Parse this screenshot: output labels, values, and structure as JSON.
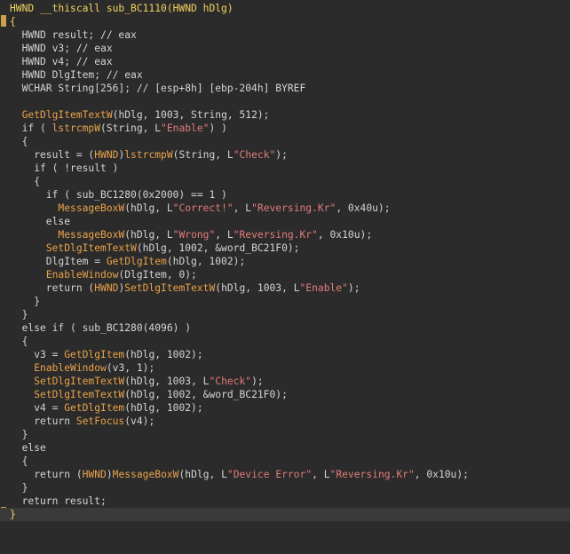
{
  "editor": {
    "signature": "HWND __thiscall sub_BC1110(HWND hDlg)",
    "lines": [
      [
        {
          "t": "HWND __thiscall sub_BC1110(HWND hDlg)",
          "c": "head"
        }
      ],
      [
        {
          "t": "{",
          "c": "brace"
        }
      ],
      [
        {
          "t": "  HWND result; // eax",
          "c": "var"
        }
      ],
      [
        {
          "t": "  HWND v3; // eax",
          "c": "var"
        }
      ],
      [
        {
          "t": "  HWND v4; // eax",
          "c": "var"
        }
      ],
      [
        {
          "t": "  HWND DlgItem; // eax",
          "c": "var"
        }
      ],
      [
        {
          "t": "  WCHAR String[256]; // [esp+8h] [ebp-204h] BYREF",
          "c": "var"
        }
      ],
      [
        {
          "t": "",
          "c": "var"
        }
      ],
      [
        {
          "t": "  ",
          "c": "var"
        },
        {
          "t": "GetDlgItemTextW",
          "c": "fn"
        },
        {
          "t": "(hDlg, 1003, String, 512);",
          "c": "var"
        }
      ],
      [
        {
          "t": "  if ( ",
          "c": "var"
        },
        {
          "t": "lstrcmpW",
          "c": "fn"
        },
        {
          "t": "(String, L",
          "c": "var"
        },
        {
          "t": "\"Enable\"",
          "c": "str"
        },
        {
          "t": ") )",
          "c": "var"
        }
      ],
      [
        {
          "t": "  {",
          "c": "var"
        }
      ],
      [
        {
          "t": "    result = (",
          "c": "var"
        },
        {
          "t": "HWND",
          "c": "fn"
        },
        {
          "t": ")",
          "c": "var"
        },
        {
          "t": "lstrcmpW",
          "c": "fn"
        },
        {
          "t": "(String, L",
          "c": "var"
        },
        {
          "t": "\"Check\"",
          "c": "str"
        },
        {
          "t": ");",
          "c": "var"
        }
      ],
      [
        {
          "t": "    if ( !result )",
          "c": "var"
        }
      ],
      [
        {
          "t": "    {",
          "c": "var"
        }
      ],
      [
        {
          "t": "      if ( sub_BC1280(0x2000) == 1 )",
          "c": "var"
        }
      ],
      [
        {
          "t": "        ",
          "c": "var"
        },
        {
          "t": "MessageBoxW",
          "c": "fn"
        },
        {
          "t": "(hDlg, L",
          "c": "var"
        },
        {
          "t": "\"Correct!\"",
          "c": "str"
        },
        {
          "t": ", L",
          "c": "var"
        },
        {
          "t": "\"Reversing.Kr\"",
          "c": "str"
        },
        {
          "t": ", 0x40u);",
          "c": "var"
        }
      ],
      [
        {
          "t": "      else",
          "c": "var"
        }
      ],
      [
        {
          "t": "        ",
          "c": "var"
        },
        {
          "t": "MessageBoxW",
          "c": "fn"
        },
        {
          "t": "(hDlg, L",
          "c": "var"
        },
        {
          "t": "\"Wrong\"",
          "c": "str"
        },
        {
          "t": ", L",
          "c": "var"
        },
        {
          "t": "\"Reversing.Kr\"",
          "c": "str"
        },
        {
          "t": ", 0x10u);",
          "c": "var"
        }
      ],
      [
        {
          "t": "      ",
          "c": "var"
        },
        {
          "t": "SetDlgItemTextW",
          "c": "fn"
        },
        {
          "t": "(hDlg, 1002, &word_BC21F0);",
          "c": "var"
        }
      ],
      [
        {
          "t": "      DlgItem = ",
          "c": "var"
        },
        {
          "t": "GetDlgItem",
          "c": "fn"
        },
        {
          "t": "(hDlg, 1002);",
          "c": "var"
        }
      ],
      [
        {
          "t": "      ",
          "c": "var"
        },
        {
          "t": "EnableWindow",
          "c": "fn"
        },
        {
          "t": "(DlgItem, 0);",
          "c": "var"
        }
      ],
      [
        {
          "t": "      return (",
          "c": "var"
        },
        {
          "t": "HWND",
          "c": "fn"
        },
        {
          "t": ")",
          "c": "var"
        },
        {
          "t": "SetDlgItemTextW",
          "c": "fn"
        },
        {
          "t": "(hDlg, 1003, L",
          "c": "var"
        },
        {
          "t": "\"Enable\"",
          "c": "str"
        },
        {
          "t": ");",
          "c": "var"
        }
      ],
      [
        {
          "t": "    }",
          "c": "var"
        }
      ],
      [
        {
          "t": "  }",
          "c": "var"
        }
      ],
      [
        {
          "t": "  else if ( sub_BC1280(4096) )",
          "c": "var"
        }
      ],
      [
        {
          "t": "  {",
          "c": "var"
        }
      ],
      [
        {
          "t": "    v3 = ",
          "c": "var"
        },
        {
          "t": "GetDlgItem",
          "c": "fn"
        },
        {
          "t": "(hDlg, 1002);",
          "c": "var"
        }
      ],
      [
        {
          "t": "    ",
          "c": "var"
        },
        {
          "t": "EnableWindow",
          "c": "fn"
        },
        {
          "t": "(v3, 1);",
          "c": "var"
        }
      ],
      [
        {
          "t": "    ",
          "c": "var"
        },
        {
          "t": "SetDlgItemTextW",
          "c": "fn"
        },
        {
          "t": "(hDlg, 1003, L",
          "c": "var"
        },
        {
          "t": "\"Check\"",
          "c": "str"
        },
        {
          "t": ");",
          "c": "var"
        }
      ],
      [
        {
          "t": "    ",
          "c": "var"
        },
        {
          "t": "SetDlgItemTextW",
          "c": "fn"
        },
        {
          "t": "(hDlg, 1002, &word_BC21F0);",
          "c": "var"
        }
      ],
      [
        {
          "t": "    v4 = ",
          "c": "var"
        },
        {
          "t": "GetDlgItem",
          "c": "fn"
        },
        {
          "t": "(hDlg, 1002);",
          "c": "var"
        }
      ],
      [
        {
          "t": "    return ",
          "c": "var"
        },
        {
          "t": "SetFocus",
          "c": "fn"
        },
        {
          "t": "(v4);",
          "c": "var"
        }
      ],
      [
        {
          "t": "  }",
          "c": "var"
        }
      ],
      [
        {
          "t": "  else",
          "c": "var"
        }
      ],
      [
        {
          "t": "  {",
          "c": "var"
        }
      ],
      [
        {
          "t": "    return (",
          "c": "var"
        },
        {
          "t": "HWND",
          "c": "fn"
        },
        {
          "t": ")",
          "c": "var"
        },
        {
          "t": "MessageBoxW",
          "c": "fn"
        },
        {
          "t": "(hDlg, L",
          "c": "var"
        },
        {
          "t": "\"Device Error\"",
          "c": "str"
        },
        {
          "t": ", L",
          "c": "var"
        },
        {
          "t": "\"Reversing.Kr\"",
          "c": "str"
        },
        {
          "t": ", 0x10u);",
          "c": "var"
        }
      ],
      [
        {
          "t": "  }",
          "c": "var"
        }
      ],
      [
        {
          "t": "  return result;",
          "c": "var"
        }
      ],
      [
        {
          "t": "}",
          "c": "brace"
        }
      ]
    ]
  },
  "colors": {
    "background": "#2b2b2b",
    "function": "#e8a24a",
    "string": "#e07c79",
    "text": "#d4d4d4",
    "brace_highlight": "#f3d25f"
  }
}
